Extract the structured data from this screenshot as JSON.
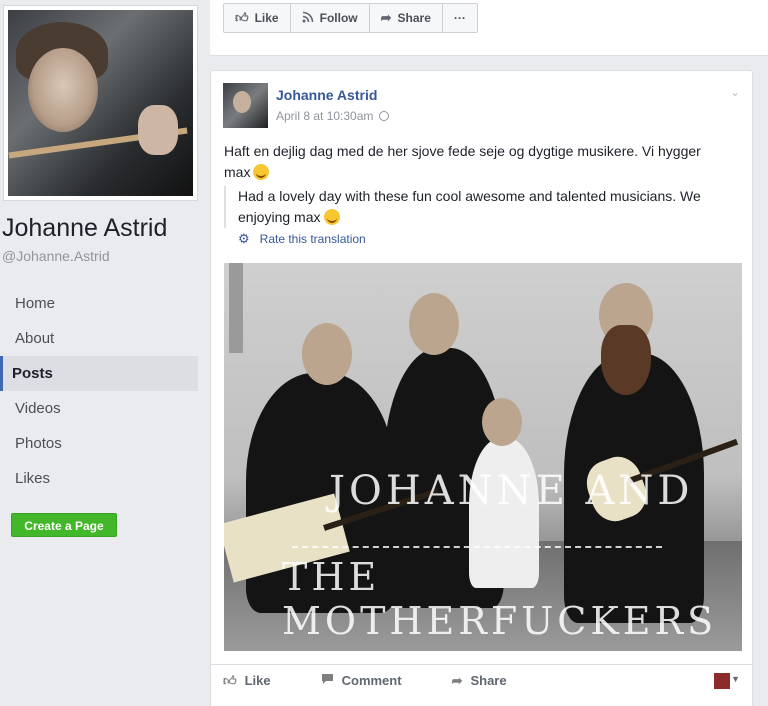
{
  "profile": {
    "name": "Johanne Astrid",
    "handle": "@Johanne.Astrid"
  },
  "nav": {
    "items": [
      {
        "label": "Home",
        "active": false
      },
      {
        "label": "About",
        "active": false
      },
      {
        "label": "Posts",
        "active": true
      },
      {
        "label": "Videos",
        "active": false
      },
      {
        "label": "Photos",
        "active": false
      },
      {
        "label": "Likes",
        "active": false
      }
    ],
    "create_page": "Create a Page"
  },
  "action_bar": {
    "like": "Like",
    "follow": "Follow",
    "share": "Share",
    "more": "···"
  },
  "post": {
    "author": "Johanne Astrid",
    "timestamp": "April 8 at 10:30am",
    "text": "Haft en dejlig dag med de her sjove fede seje og dygtige musikere. Vi hygger max",
    "translation": "Had a lovely day with these fun cool awesome and talented musicians. We enjoying max",
    "rate_translation": "Rate this translation",
    "photo_watermark_line1": "JOHANNE AND",
    "photo_watermark_line2": "THE MOTHERFUCKERS",
    "actions": {
      "like": "Like",
      "comment": "Comment",
      "share": "Share"
    }
  },
  "colors": {
    "link": "#365899",
    "create_button": "#42b72a",
    "active_nav_border": "#4267b2"
  }
}
